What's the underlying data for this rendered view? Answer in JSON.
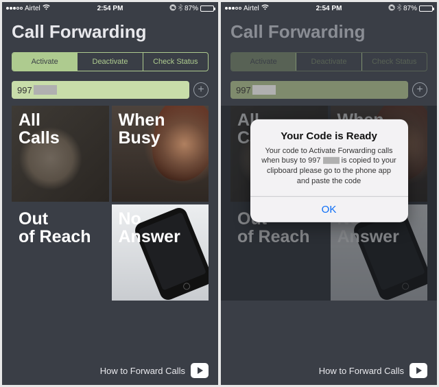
{
  "status": {
    "carrier": "Airtel",
    "time": "2:54 PM",
    "battery": "87%"
  },
  "title": "Call Forwarding",
  "tabs": {
    "activate": "Activate",
    "deactivate": "Deactivate",
    "check": "Check Status"
  },
  "phone": {
    "value": "997"
  },
  "tiles": {
    "all": "All Calls",
    "busy": "When Busy",
    "reach": "Out of Reach",
    "answer": "No Answer"
  },
  "footer": {
    "howto": "How to Forward Calls"
  },
  "alert": {
    "title": "Your Code is Ready",
    "msg1": "Your code to Activate Forwarding calls when busy to 997",
    "msg2": "is copied to your clipboard please go to the phone app and paste the code",
    "ok": "OK"
  }
}
